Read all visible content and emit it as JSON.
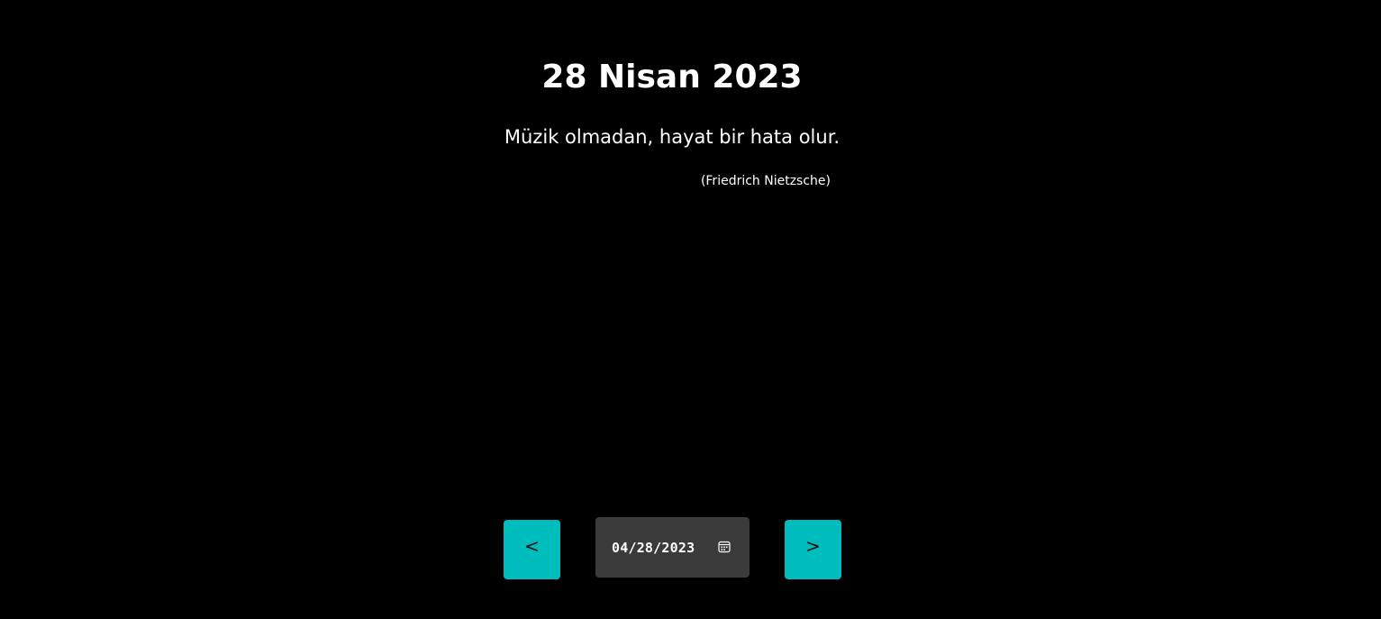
{
  "header": {
    "date_title": "28 Nisan 2023"
  },
  "quote": {
    "text": "Müzik olmadan, hayat bir hata olur.",
    "author": "(Friedrich Nietzsche)"
  },
  "controls": {
    "prev_label": "<",
    "next_label": ">",
    "date_value": "04/28/2023",
    "calendar_icon": "calendar-icon"
  },
  "colors": {
    "background": "#000000",
    "accent": "#00bdbd",
    "date_field_bg": "#3b3b3b",
    "text": "#ffffff"
  }
}
